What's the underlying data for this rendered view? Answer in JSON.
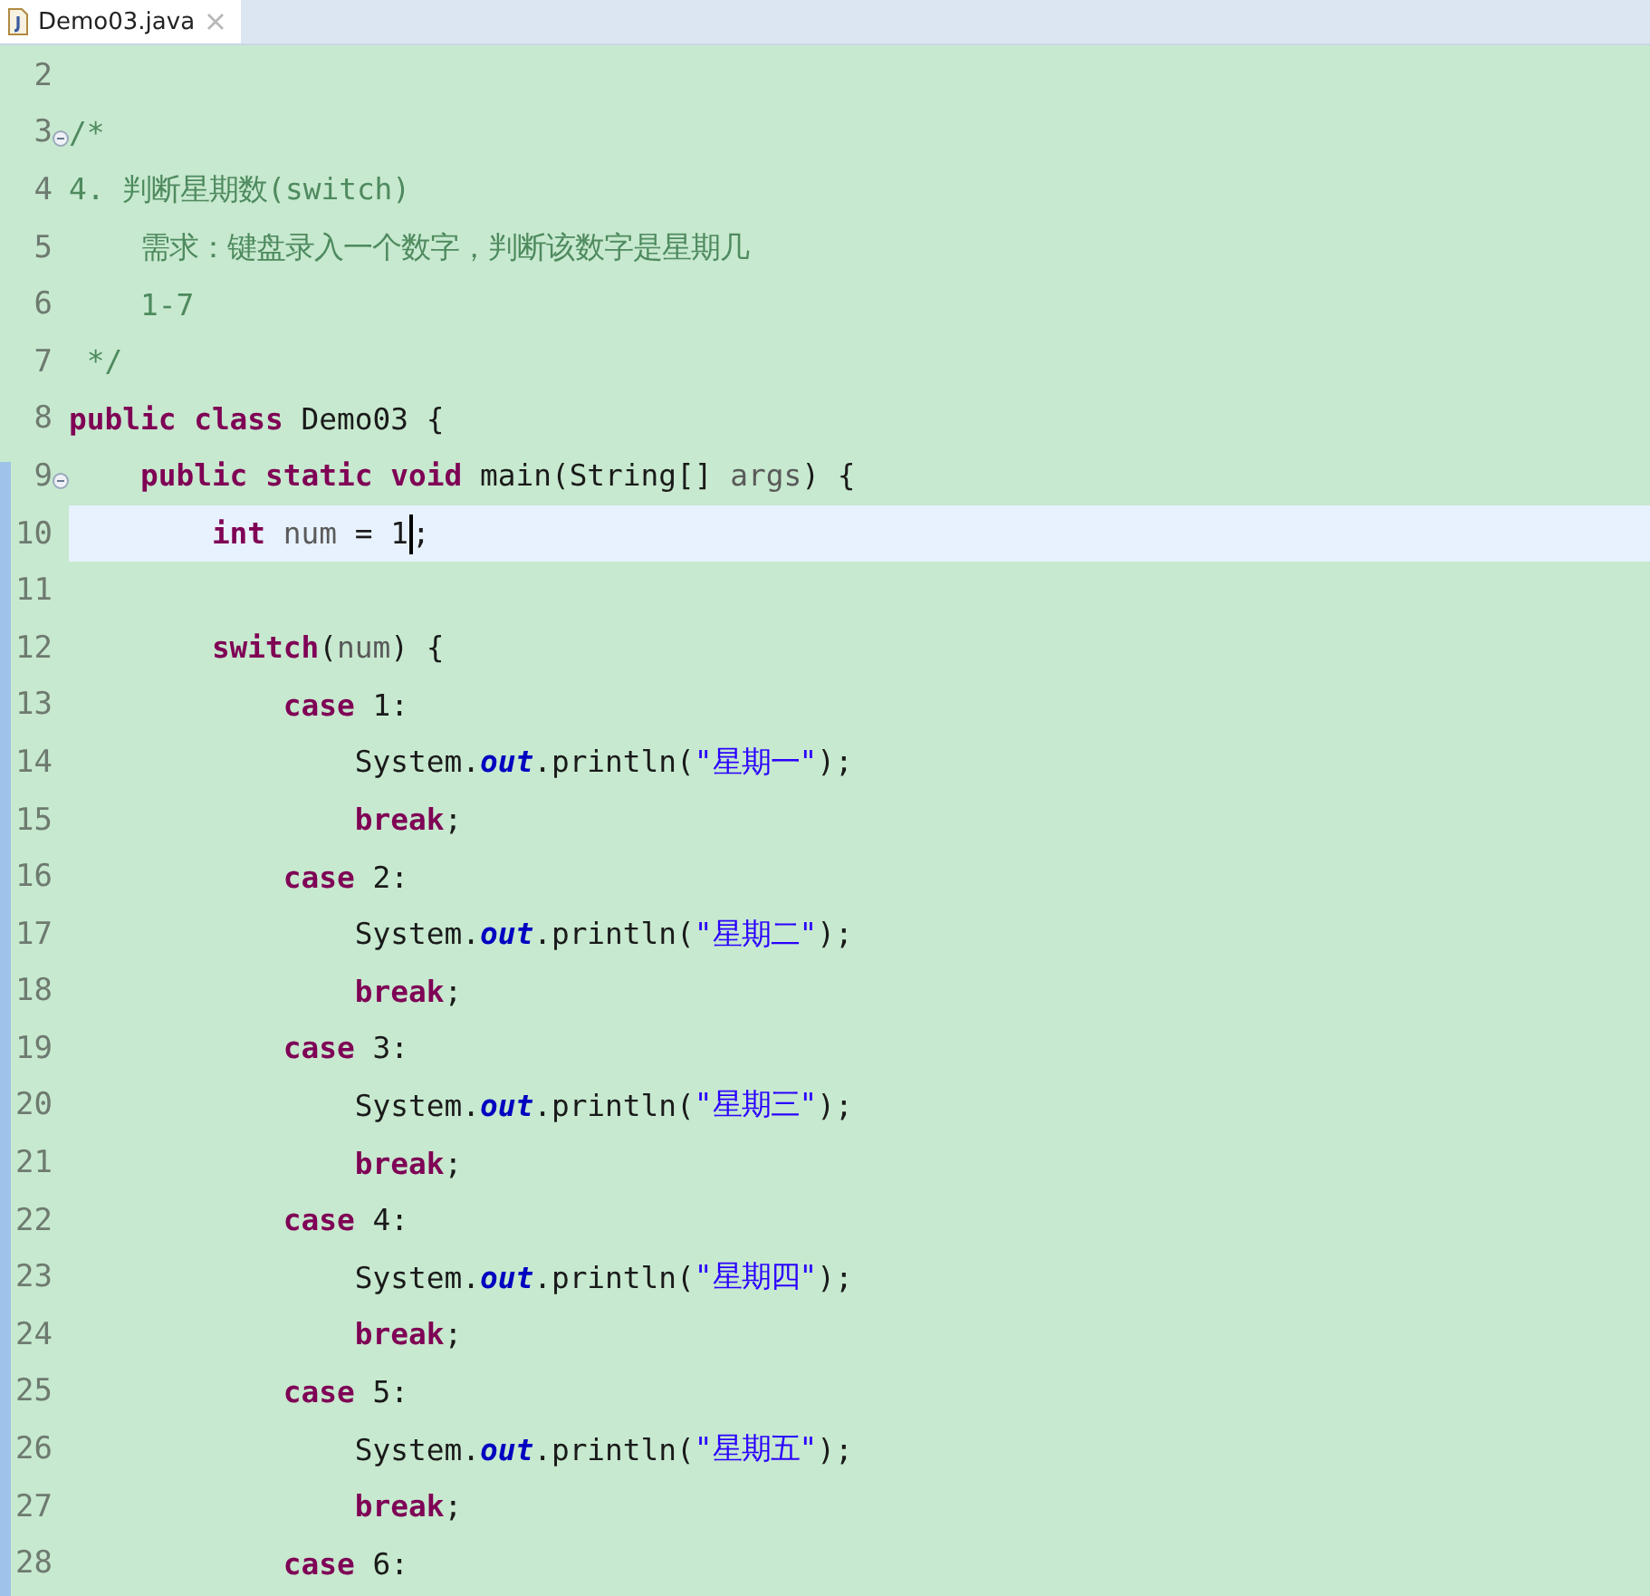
{
  "tabs": [
    {
      "label": "Demo03.java",
      "selected": true
    }
  ],
  "editor": {
    "lines": [
      {
        "number": "2",
        "current": false,
        "fold": false
      },
      {
        "number": "3",
        "current": false,
        "fold": true,
        "tokens": [
          {
            "text": "/*",
            "kind": "comment"
          }
        ]
      },
      {
        "number": "4",
        "current": false,
        "fold": false,
        "tokens": [
          {
            "text": "4. 判断星期数(switch)",
            "kind": "comment"
          }
        ]
      },
      {
        "number": "5",
        "current": false,
        "fold": false,
        "tokens": [
          {
            "text": "    需求：键盘录入一个数字，判断该数字是星期几",
            "kind": "comment"
          }
        ]
      },
      {
        "number": "6",
        "current": false,
        "fold": false,
        "tokens": [
          {
            "text": "    1-7",
            "kind": "comment"
          }
        ]
      },
      {
        "number": "7",
        "current": false,
        "fold": false,
        "tokens": [
          {
            "text": " */",
            "kind": "comment"
          }
        ]
      },
      {
        "number": "8",
        "current": false,
        "fold": false,
        "tokens": [
          {
            "text": "public class",
            "kind": "keyword"
          },
          {
            "text": " Demo03 {",
            "kind": "plain"
          }
        ]
      },
      {
        "number": "9",
        "current": false,
        "fold": true,
        "tokens": [
          {
            "text": "    public static void",
            "kind": "keyword"
          },
          {
            "text": " main(String[] ",
            "kind": "plain"
          },
          {
            "text": "args",
            "kind": "variable"
          },
          {
            "text": ") {",
            "kind": "plain"
          }
        ]
      },
      {
        "number": "10",
        "current": true,
        "fold": false,
        "tokens": [
          {
            "text": "        int ",
            "kind": "keyword"
          },
          {
            "text": "num",
            "kind": "variable"
          },
          {
            "text": " = 1",
            "kind": "plain"
          },
          {
            "kind": "caret"
          },
          {
            "text": ";",
            "kind": "plain"
          }
        ]
      },
      {
        "number": "11",
        "current": false,
        "fold": false
      },
      {
        "number": "12",
        "current": false,
        "fold": false,
        "tokens": [
          {
            "text": "        switch",
            "kind": "keyword"
          },
          {
            "text": "(",
            "kind": "plain"
          },
          {
            "text": "num",
            "kind": "variable"
          },
          {
            "text": ") {",
            "kind": "plain"
          }
        ]
      },
      {
        "number": "13",
        "current": false,
        "fold": false,
        "tokens": [
          {
            "text": "            case",
            "kind": "keyword"
          },
          {
            "text": " 1:",
            "kind": "plain"
          }
        ]
      },
      {
        "number": "14",
        "current": false,
        "fold": false,
        "tokens": [
          {
            "text": "                System.",
            "kind": "plain"
          },
          {
            "text": "out",
            "kind": "field"
          },
          {
            "text": ".println(",
            "kind": "plain"
          },
          {
            "text": "\"星期一\"",
            "kind": "string"
          },
          {
            "text": ");",
            "kind": "plain"
          }
        ]
      },
      {
        "number": "15",
        "current": false,
        "fold": false,
        "tokens": [
          {
            "text": "                break",
            "kind": "keyword"
          },
          {
            "text": ";",
            "kind": "plain"
          }
        ]
      },
      {
        "number": "16",
        "current": false,
        "fold": false,
        "tokens": [
          {
            "text": "            case",
            "kind": "keyword"
          },
          {
            "text": " 2:",
            "kind": "plain"
          }
        ]
      },
      {
        "number": "17",
        "current": false,
        "fold": false,
        "tokens": [
          {
            "text": "                System.",
            "kind": "plain"
          },
          {
            "text": "out",
            "kind": "field"
          },
          {
            "text": ".println(",
            "kind": "plain"
          },
          {
            "text": "\"星期二\"",
            "kind": "string"
          },
          {
            "text": ");",
            "kind": "plain"
          }
        ]
      },
      {
        "number": "18",
        "current": false,
        "fold": false,
        "tokens": [
          {
            "text": "                break",
            "kind": "keyword"
          },
          {
            "text": ";",
            "kind": "plain"
          }
        ]
      },
      {
        "number": "19",
        "current": false,
        "fold": false,
        "tokens": [
          {
            "text": "            case",
            "kind": "keyword"
          },
          {
            "text": " 3:",
            "kind": "plain"
          }
        ]
      },
      {
        "number": "20",
        "current": false,
        "fold": false,
        "tokens": [
          {
            "text": "                System.",
            "kind": "plain"
          },
          {
            "text": "out",
            "kind": "field"
          },
          {
            "text": ".println(",
            "kind": "plain"
          },
          {
            "text": "\"星期三\"",
            "kind": "string"
          },
          {
            "text": ");",
            "kind": "plain"
          }
        ]
      },
      {
        "number": "21",
        "current": false,
        "fold": false,
        "tokens": [
          {
            "text": "                break",
            "kind": "keyword"
          },
          {
            "text": ";",
            "kind": "plain"
          }
        ]
      },
      {
        "number": "22",
        "current": false,
        "fold": false,
        "tokens": [
          {
            "text": "            case",
            "kind": "keyword"
          },
          {
            "text": " 4:",
            "kind": "plain"
          }
        ]
      },
      {
        "number": "23",
        "current": false,
        "fold": false,
        "tokens": [
          {
            "text": "                System.",
            "kind": "plain"
          },
          {
            "text": "out",
            "kind": "field"
          },
          {
            "text": ".println(",
            "kind": "plain"
          },
          {
            "text": "\"星期四\"",
            "kind": "string"
          },
          {
            "text": ");",
            "kind": "plain"
          }
        ]
      },
      {
        "number": "24",
        "current": false,
        "fold": false,
        "tokens": [
          {
            "text": "                break",
            "kind": "keyword"
          },
          {
            "text": ";",
            "kind": "plain"
          }
        ]
      },
      {
        "number": "25",
        "current": false,
        "fold": false,
        "tokens": [
          {
            "text": "            case",
            "kind": "keyword"
          },
          {
            "text": " 5:",
            "kind": "plain"
          }
        ]
      },
      {
        "number": "26",
        "current": false,
        "fold": false,
        "tokens": [
          {
            "text": "                System.",
            "kind": "plain"
          },
          {
            "text": "out",
            "kind": "field"
          },
          {
            "text": ".println(",
            "kind": "plain"
          },
          {
            "text": "\"星期五\"",
            "kind": "string"
          },
          {
            "text": ");",
            "kind": "plain"
          }
        ]
      },
      {
        "number": "27",
        "current": false,
        "fold": false,
        "tokens": [
          {
            "text": "                break",
            "kind": "keyword"
          },
          {
            "text": ";",
            "kind": "plain"
          }
        ]
      },
      {
        "number": "28",
        "current": false,
        "fold": false,
        "tokens": [
          {
            "text": "            case",
            "kind": "keyword"
          },
          {
            "text": " 6:",
            "kind": "plain"
          }
        ]
      }
    ]
  }
}
